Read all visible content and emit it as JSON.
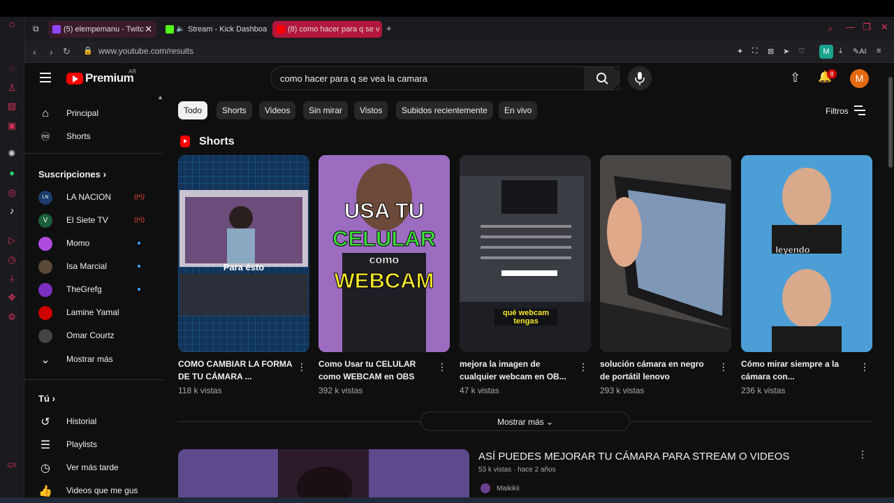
{
  "browser": {
    "tabs": [
      {
        "label": "(5) elempemanu - Twitc",
        "color": "#9146ff"
      },
      {
        "label": "Stream - Kick Dashboa",
        "color": "#53fc18"
      },
      {
        "label": "(8) como hacer para q se v",
        "color": "#ff0000"
      }
    ],
    "url": "www.youtube.com/results",
    "ai_label": "AI",
    "profile_badge": "M"
  },
  "header": {
    "logo_text": "Premium",
    "country": "AR",
    "search_query": "como hacer para q se vea la camara",
    "notifications": "8",
    "avatar_letter": "M"
  },
  "sidebar": {
    "main": [
      {
        "label": "Principal",
        "icon": "home-icon"
      },
      {
        "label": "Shorts",
        "icon": "shorts-icon"
      }
    ],
    "subs_heading": "Suscripciones",
    "subscriptions": [
      {
        "label": "LA NACION",
        "status": "live",
        "avatar_text": "LN",
        "color": "#1a3c6e"
      },
      {
        "label": "El Siete TV",
        "status": "live",
        "avatar_text": "V",
        "color": "#1b5e3a"
      },
      {
        "label": "Momo",
        "status": "new",
        "avatar_text": "",
        "color": "#b04be0"
      },
      {
        "label": "Isa Marcial",
        "status": "new",
        "avatar_text": "",
        "color": "#5a4a3a"
      },
      {
        "label": "TheGrefg",
        "status": "new",
        "avatar_text": "",
        "color": "#7a2fc2"
      },
      {
        "label": "Lamine Yamal",
        "status": "none",
        "avatar_text": "",
        "color": "#d00000"
      },
      {
        "label": "Omar Courtz",
        "status": "none",
        "avatar_text": "",
        "color": "#444"
      }
    ],
    "show_more": "Mostrar más",
    "you_heading": "Tú",
    "you_items": [
      {
        "label": "Historial",
        "icon": "history-icon"
      },
      {
        "label": "Playlists",
        "icon": "playlist-icon"
      },
      {
        "label": "Ver más tarde",
        "icon": "clock-icon"
      },
      {
        "label": "Videos que me gus",
        "icon": "like-icon"
      }
    ]
  },
  "chips": [
    "Todo",
    "Shorts",
    "Videos",
    "Sin mirar",
    "Vistos",
    "Subidos recientemente",
    "En vivo"
  ],
  "filters_label": "Filtros",
  "shorts": {
    "heading": "Shorts",
    "items": [
      {
        "title": "COMO CAMBIAR LA FORMA DE TU CÁMARA ...",
        "views": "118 k vistas",
        "overlay": "Para ésto"
      },
      {
        "title": "Como Usar tu CELULAR como WEBCAM en OBS",
        "views": "392 k vistas",
        "overlay_lines": [
          "USA TU",
          "CELULAR",
          "como",
          "WEBCAM"
        ]
      },
      {
        "title": "mejora la imagen de cualquier webcam en OB...",
        "views": "47 k vistas",
        "overlay": "qué webcam tengas"
      },
      {
        "title": "solución cámara en negro de portátil lenovo",
        "views": "293 k vistas",
        "overlay": ""
      },
      {
        "title": "Cómo mirar siempre a la cámara con...",
        "views": "236 k vistas",
        "overlay": "leyendo"
      }
    ],
    "show_more": "Mostrar más"
  },
  "video": {
    "title": "ASÍ PUEDES MEJORAR TU CÁMARA PARA STREAM O VIDEOS",
    "meta": "53 k vistas · hace 2 años",
    "channel": "Maikikii"
  }
}
